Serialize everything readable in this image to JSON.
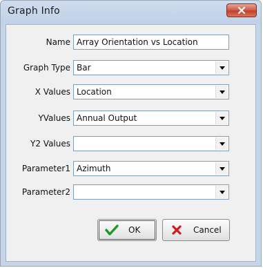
{
  "window": {
    "title": "Graph Info",
    "close_icon": "close-icon"
  },
  "form": {
    "name": {
      "label": "Name",
      "value": "Array Orientation vs Location"
    },
    "graph_type": {
      "label": "Graph Type",
      "value": "Bar"
    },
    "x_values": {
      "label": "X Values",
      "value": "Location"
    },
    "y_values": {
      "label": "YValues",
      "value": "Annual Output"
    },
    "y2_values": {
      "label": "Y2 Values",
      "value": ""
    },
    "parameter1": {
      "label": "Parameter1",
      "value": "Azimuth"
    },
    "parameter2": {
      "label": "Parameter2",
      "value": ""
    }
  },
  "buttons": {
    "ok": {
      "label": "OK",
      "icon": "checkmark-icon",
      "icon_color": "#1a9a2a"
    },
    "cancel": {
      "label": "Cancel",
      "icon": "x-icon",
      "icon_color": "#d21a1a"
    }
  }
}
